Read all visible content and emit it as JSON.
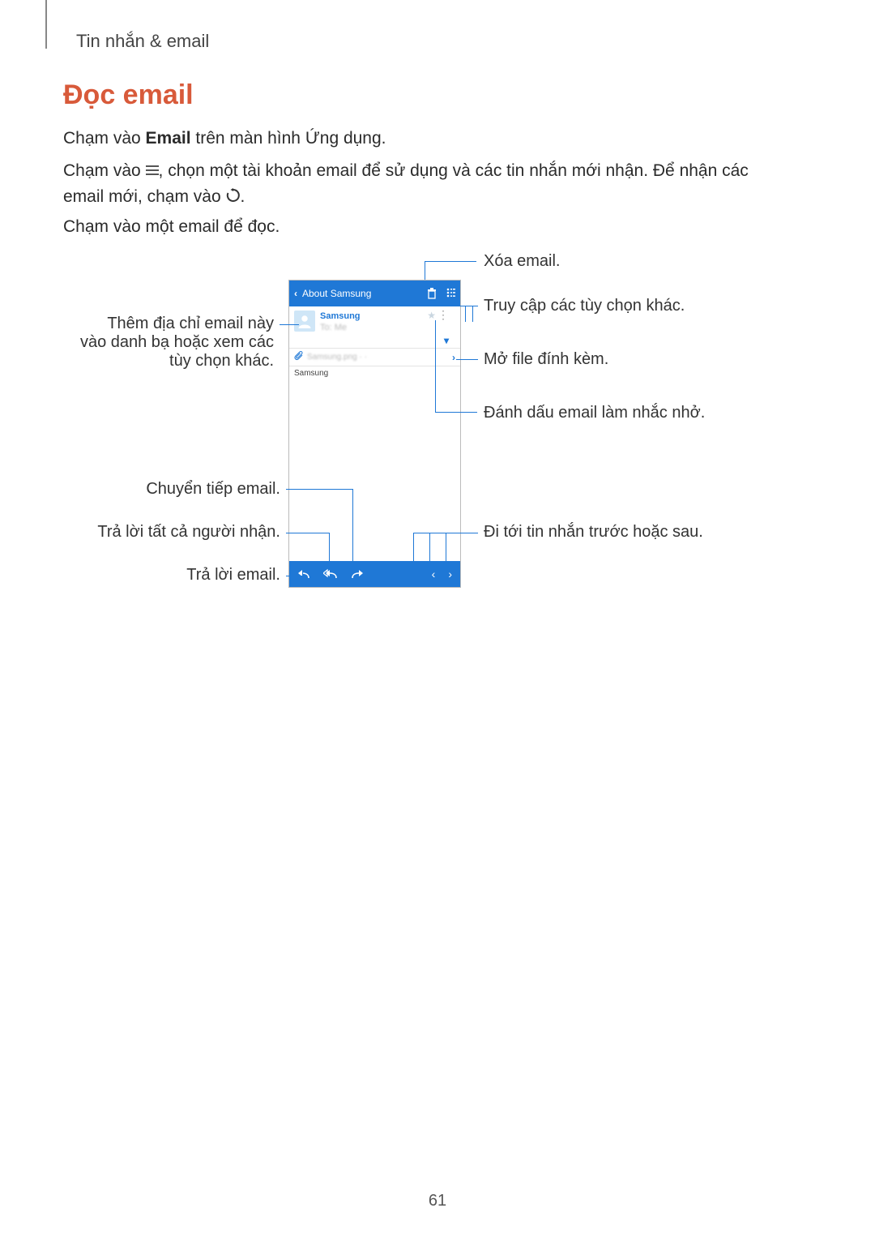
{
  "breadcrumb": "Tin nhắn & email",
  "section_title": "Đọc email",
  "para1_pre": "Chạm vào ",
  "para1_bold": "Email",
  "para1_post": " trên màn hình Ứng dụng.",
  "para2_a": "Chạm vào ",
  "para2_b": ", chọn một tài khoản email để sử dụng và các tin nhắn mới nhận. Để nhận các email mới, chạm vào ",
  "para2_c": ".",
  "para3": "Chạm vào một email để đọc.",
  "phone": {
    "title": "About Samsung",
    "sender": "Samsung",
    "sender_sub": "To: Me",
    "attach_name": "Samsung.png  ·  · ",
    "body": "Samsung"
  },
  "callouts": {
    "delete": "Xóa email.",
    "more_options": "Truy cập các tùy chọn khác.",
    "open_attachment": "Mở file đính kèm.",
    "flag_reminder": "Đánh dấu email làm nhắc nhở.",
    "prev_next": "Đi tới tin nhắn trước hoặc sau.",
    "add_contact": "Thêm địa chỉ email này vào danh bạ hoặc xem các tùy chọn khác.",
    "forward": "Chuyển tiếp email.",
    "reply_all": "Trả lời tất cả người nhận.",
    "reply": "Trả lời email."
  },
  "page_number": "61"
}
